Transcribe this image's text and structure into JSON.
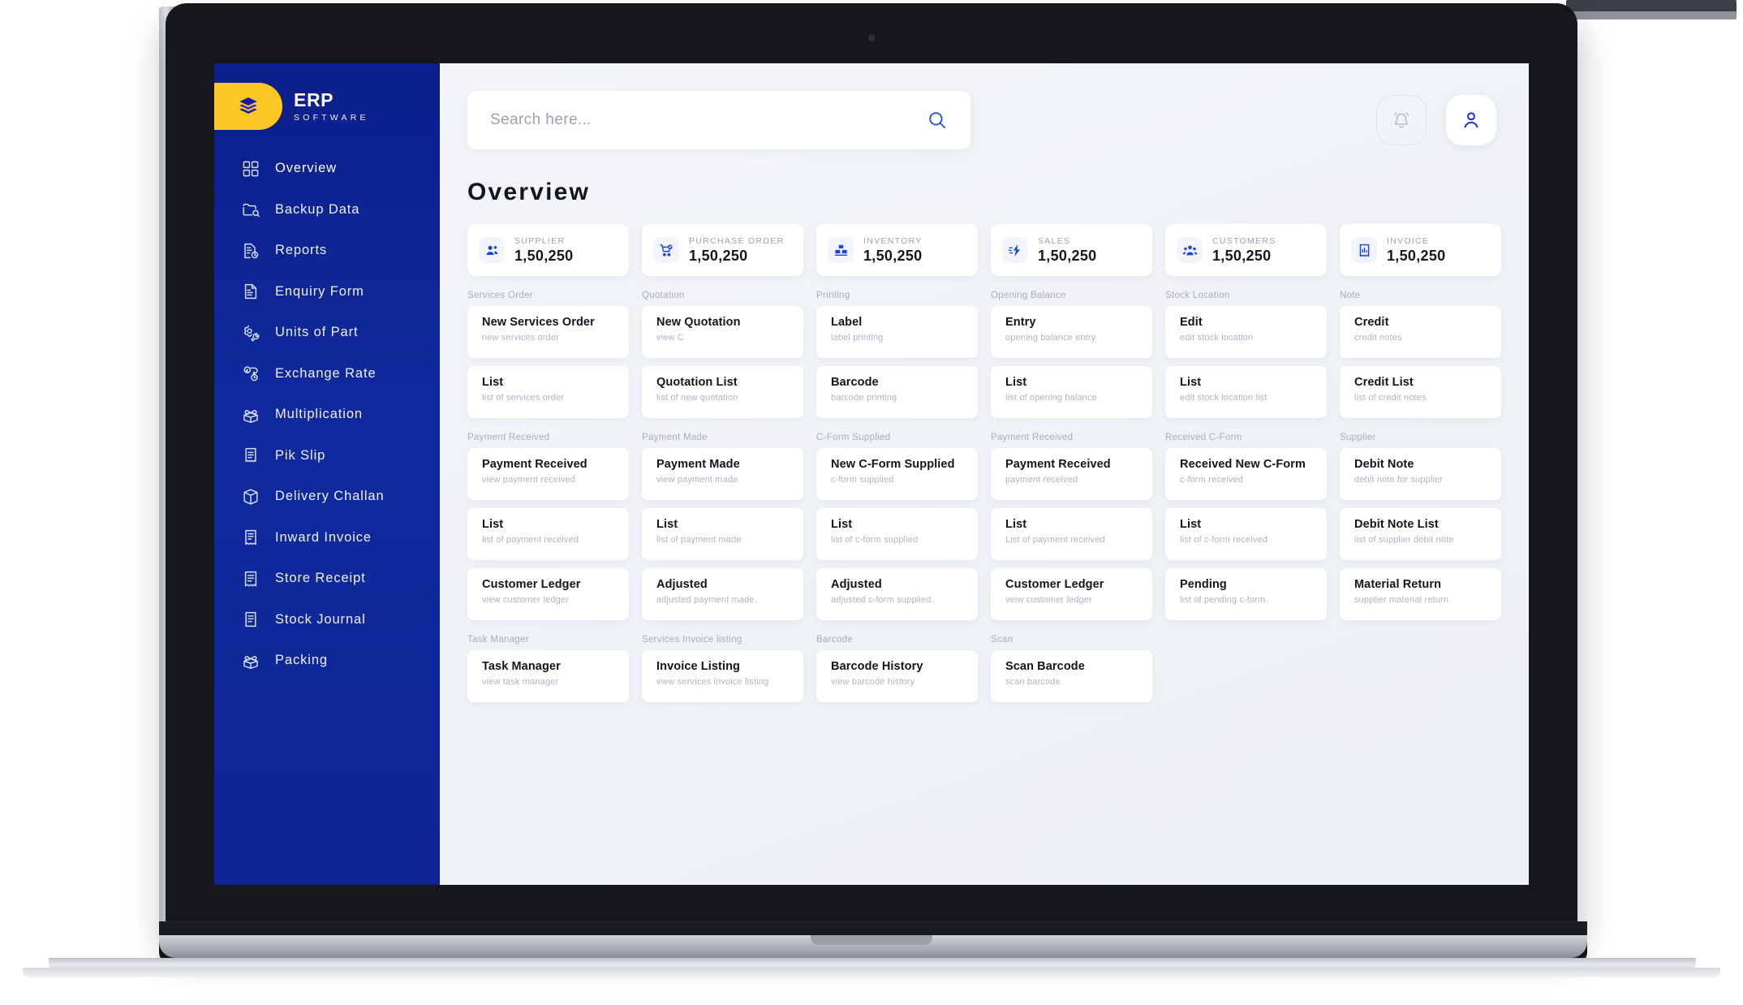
{
  "brand": {
    "title": "ERP",
    "subtitle": "SOFTWARE"
  },
  "sidebar": {
    "items": [
      {
        "label": "Overview",
        "icon": "grid-icon",
        "active": true
      },
      {
        "label": "Backup Data",
        "icon": "backup-icon",
        "active": false
      },
      {
        "label": "Reports",
        "icon": "report-icon",
        "active": false
      },
      {
        "label": "Enquiry Form",
        "icon": "document-icon",
        "active": false
      },
      {
        "label": "Units of Part",
        "icon": "gear-wrench-icon",
        "active": false
      },
      {
        "label": "Exchange Rate",
        "icon": "exchange-icon",
        "active": false
      },
      {
        "label": "Multiplication",
        "icon": "open-box-icon",
        "active": false
      },
      {
        "label": "Pik Slip",
        "icon": "receipt-icon",
        "active": false
      },
      {
        "label": "Delivery Challan",
        "icon": "box-icon",
        "active": false
      },
      {
        "label": "Inward Invoice",
        "icon": "invoice-icon",
        "active": false
      },
      {
        "label": "Store Receipt",
        "icon": "store-receipt-icon",
        "active": false
      },
      {
        "label": "Stock Journal",
        "icon": "journal-icon",
        "active": false
      },
      {
        "label": "Packing",
        "icon": "packing-icon",
        "active": false
      }
    ]
  },
  "topbar": {
    "search_placeholder": "Search here...",
    "search_value": "",
    "search_icon": "search-icon",
    "bell_icon": "bell-icon",
    "user_icon": "user-avatar-icon"
  },
  "page": {
    "title": "Overview"
  },
  "stats": [
    {
      "label": "SUPPLIER",
      "value": "1,50,250",
      "icon": "users-icon"
    },
    {
      "label": "PURCHASE ORDER",
      "value": "1,50,250",
      "icon": "cart-check-icon"
    },
    {
      "label": "INVENTORY",
      "value": "1,50,250",
      "icon": "inventory-icon"
    },
    {
      "label": "SALES",
      "value": "1,50,250",
      "icon": "sales-bolt-icon"
    },
    {
      "label": "CUSTOMERS",
      "value": "1,50,250",
      "icon": "customers-icon"
    },
    {
      "label": "INVOICE",
      "value": "1,50,250",
      "icon": "invoice-chart-icon"
    }
  ],
  "blocks": [
    {
      "labels": [
        "Services Order",
        "Quotation",
        "Printing",
        "Opening Balance",
        "Stock Location",
        "Note"
      ],
      "rows": [
        [
          {
            "title": "New Services Order",
            "sub": "new services order"
          },
          {
            "title": "New Quotation",
            "sub": "view C"
          },
          {
            "title": "Label",
            "sub": "label printing"
          },
          {
            "title": "Entry",
            "sub": "opening balance entry"
          },
          {
            "title": "Edit",
            "sub": "edit stock location"
          },
          {
            "title": "Credit",
            "sub": "credit notes"
          }
        ],
        [
          {
            "title": "List",
            "sub": "list of services order"
          },
          {
            "title": "Quotation List",
            "sub": "list of new quotation"
          },
          {
            "title": "Barcode",
            "sub": "barcode printing"
          },
          {
            "title": "List",
            "sub": "list of opening balance"
          },
          {
            "title": "List",
            "sub": "edit stock location list"
          },
          {
            "title": "Credit List",
            "sub": "list of credit notes"
          }
        ]
      ]
    },
    {
      "labels": [
        "Payment Received",
        "Payment Made",
        "C-Form Supplied",
        "Payment Received",
        "Received C-Form",
        "Supplier"
      ],
      "rows": [
        [
          {
            "title": "Payment Received",
            "sub": "view payment received"
          },
          {
            "title": "Payment Made",
            "sub": "view  payment made"
          },
          {
            "title": "New C-Form Supplied",
            "sub": "c-form supplied"
          },
          {
            "title": "Payment Received",
            "sub": "payment received"
          },
          {
            "title": "Received New C-Form",
            "sub": "c-form received"
          },
          {
            "title": "Debit Note",
            "sub": "debit note for supplier"
          }
        ],
        [
          {
            "title": "List",
            "sub": "list of payment received"
          },
          {
            "title": "List",
            "sub": "list of payment made"
          },
          {
            "title": "List",
            "sub": "list of  c-form supplied"
          },
          {
            "title": "List",
            "sub": "List of payment received"
          },
          {
            "title": "List",
            "sub": "list of c-form received"
          },
          {
            "title": "Debit Note List",
            "sub": "list of supplier debit note"
          }
        ],
        [
          {
            "title": "Customer Ledger",
            "sub": "view customer ledger"
          },
          {
            "title": "Adjusted",
            "sub": "adjusted payment made."
          },
          {
            "title": "Adjusted",
            "sub": "adjusted c-form supplied."
          },
          {
            "title": "Customer Ledger",
            "sub": "veiw customer ledger"
          },
          {
            "title": "Pending",
            "sub": "list of pending c-form."
          },
          {
            "title": "Material Return",
            "sub": "supplier material return"
          }
        ]
      ]
    },
    {
      "labels": [
        "Task Manager",
        "Services Invoice listing",
        "Barcode",
        "Scan",
        "",
        ""
      ],
      "rows": [
        [
          {
            "title": "Task Manager",
            "sub": "view task manager"
          },
          {
            "title": "Invoice Listing",
            "sub": "view services invoice listing"
          },
          {
            "title": "Barcode History",
            "sub": "view barcode history"
          },
          {
            "title": "Scan Barcode",
            "sub": "scan barcode"
          },
          {
            "title": "",
            "sub": "",
            "empty": true
          },
          {
            "title": "",
            "sub": "",
            "empty": true
          }
        ]
      ]
    }
  ],
  "colors": {
    "sidebar_blue": "#0e2698",
    "brand_yellow": "#ffc726",
    "accent_blue": "#1340d8",
    "page_bg": "#f1f3f7",
    "card_bg": "#ffffff"
  }
}
